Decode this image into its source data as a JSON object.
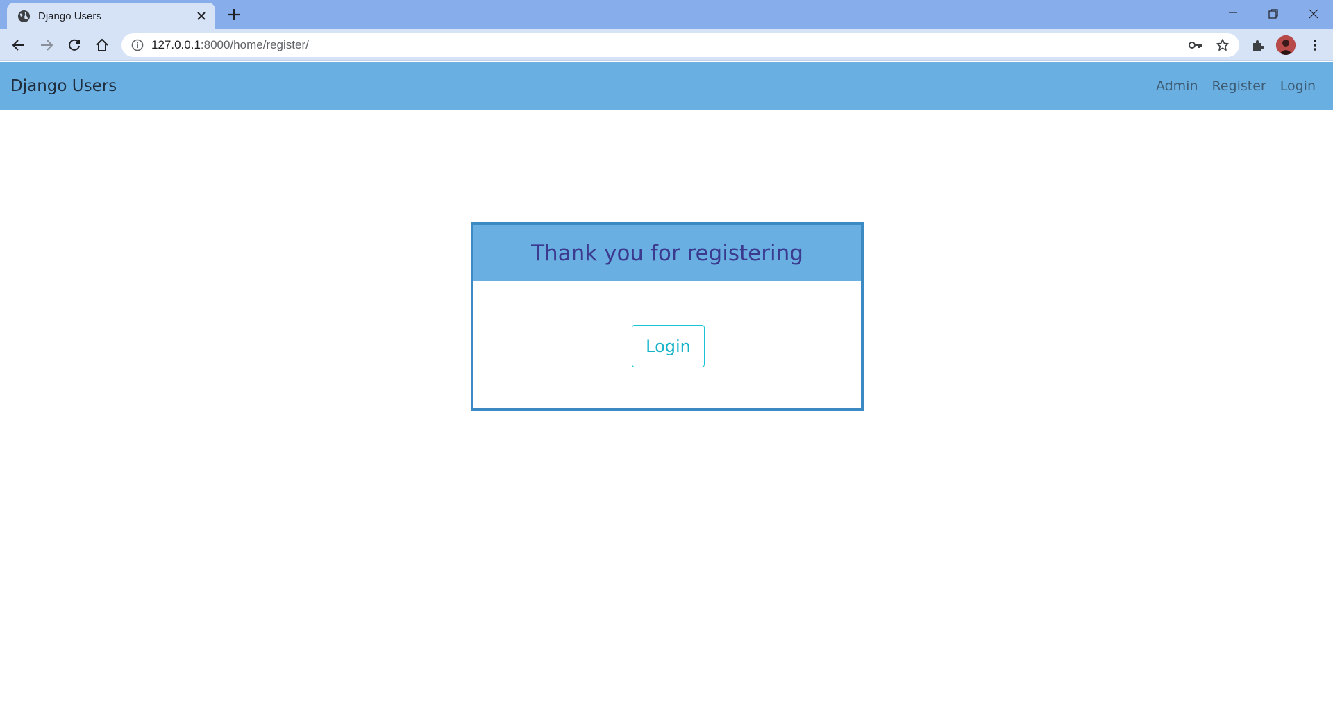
{
  "browser": {
    "tab": {
      "title": "Django Users",
      "favicon": "globe-icon"
    },
    "omnibox": {
      "host": "127.0.0.1",
      "path": ":8000/home/register/"
    },
    "icons": [
      "back-arrow-icon",
      "forward-arrow-icon",
      "reload-icon",
      "home-icon",
      "info-icon",
      "key-icon",
      "star-icon",
      "extensions-icon",
      "kebab-menu-icon",
      "minimize-icon",
      "restore-icon",
      "close-icon",
      "new-tab-icon"
    ]
  },
  "navbar": {
    "brand": "Django Users",
    "links": [
      "Admin",
      "Register",
      "Login"
    ]
  },
  "card": {
    "title": "Thank you for registering",
    "button_label": "Login"
  },
  "colors": {
    "navbar_bg": "#6aafe2",
    "card_border": "#3c8ac4",
    "title_text": "#3b3a8f",
    "button_accent": "#17c3d6",
    "tabstrip_bg": "#87aeeb"
  }
}
